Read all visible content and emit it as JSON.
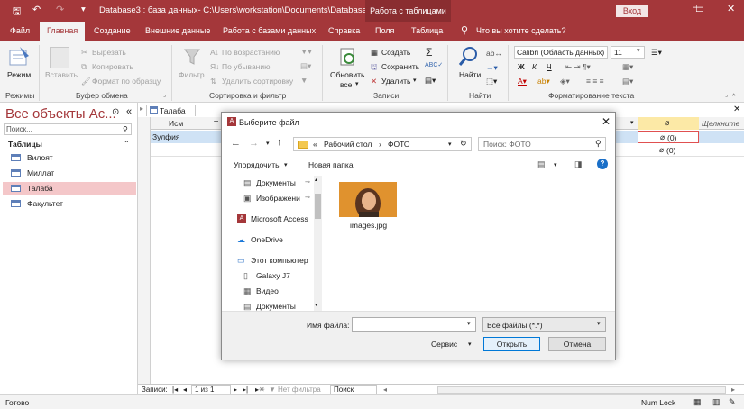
{
  "titlebar": {
    "title": "Database3 : база данных- C:\\Users\\workstation\\Documents\\Database3.ac...",
    "context_label": "Работа с таблицами",
    "signin": "Вход",
    "minimize": "—",
    "maximize": "☐",
    "close": "✕"
  },
  "tabs": [
    "Файл",
    "Главная",
    "Создание",
    "Внешние данные",
    "Работа с базами данных",
    "Справка",
    "Поля",
    "Таблица"
  ],
  "tell_me": "Что вы хотите сделать?",
  "ribbon": {
    "views": {
      "label": "Режим",
      "group": "Режимы"
    },
    "clipboard": {
      "paste": "Вставить",
      "cut": "Вырезать",
      "copy": "Копировать",
      "format_painter": "Формат по образцу",
      "group": "Буфер обмена"
    },
    "sort": {
      "filter": "Фильтр",
      "asc": "По возрастанию",
      "desc": "По убыванию",
      "remove": "Удалить сортировку",
      "group": "Сортировка и фильтр"
    },
    "records": {
      "refresh": "Обновить",
      "refresh_all": "все",
      "new": "Создать",
      "save": "Сохранить",
      "delete": "Удалить",
      "group": "Записи"
    },
    "find": {
      "find": "Найти",
      "group": "Найти"
    },
    "text": {
      "font": "Calibri (Область данных)",
      "size": "11",
      "bold": "Ж",
      "italic": "К",
      "underline": "Ч",
      "group": "Форматирование текста"
    }
  },
  "nav": {
    "title": "Все объекты Ac...",
    "search_placeholder": "Поиск...",
    "section": "Таблицы",
    "items": [
      "Вилоят",
      "Миллат",
      "Талаба",
      "Факультет"
    ]
  },
  "doc": {
    "tab": "Талаба",
    "headers": [
      "Исм",
      "Т",
      "",
      "Щелкните"
    ],
    "row_value": "Зулфия",
    "attach": "(0)"
  },
  "record_nav": {
    "label": "Записи:",
    "position": "1 из 1",
    "filter": "Нет фильтра",
    "search": "Поиск"
  },
  "status": {
    "ready": "Готово",
    "numlock": "Num Lock"
  },
  "dialog": {
    "title": "Выберите файл",
    "breadcrumb": [
      "Рабочий стол",
      "ФОТО"
    ],
    "search_placeholder": "Поиск: ФОТО",
    "organize": "Упорядочить",
    "new_folder": "Новая папка",
    "tree": [
      "Документы",
      "Изображени",
      "Microsoft Access",
      "OneDrive",
      "Этот компьютер",
      "Galaxy J7",
      "Видео",
      "Документы"
    ],
    "file": "images.jpg",
    "filename_label": "Имя файла:",
    "filetype": "Все файлы (*.*)",
    "service": "Сервис",
    "open": "Открыть",
    "cancel": "Отмена"
  },
  "colors": {
    "accent": "#a4373a",
    "ribbon_bg": "#f3f3f3",
    "selected_nav": "#f4c7c9",
    "selected_row": "#cfe2f5",
    "open_button_border": "#0078d7"
  }
}
